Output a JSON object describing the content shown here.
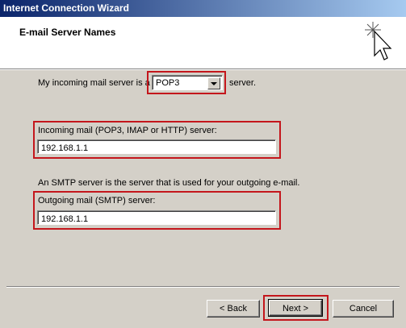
{
  "window": {
    "title": "Internet Connection Wizard"
  },
  "header": {
    "title": "E-mail Server Names",
    "icon": "wizard-sparkle-cursor-icon"
  },
  "incoming_type": {
    "prefix": "My incoming mail server is a",
    "selected": "POP3",
    "suffix": "server."
  },
  "incoming": {
    "label": "Incoming mail (POP3, IMAP or HTTP) server:",
    "value": "192.168.1.1"
  },
  "smtp_note": "An SMTP server is the server that is used for your outgoing e-mail.",
  "outgoing": {
    "label": "Outgoing mail (SMTP) server:",
    "value": "192.168.1.1"
  },
  "buttons": {
    "back": "< Back",
    "next": "Next >",
    "cancel": "Cancel"
  },
  "colors": {
    "highlight": "#c4161c",
    "title_start": "#0a246a",
    "title_end": "#a6caf0",
    "face": "#d4d0c8"
  }
}
